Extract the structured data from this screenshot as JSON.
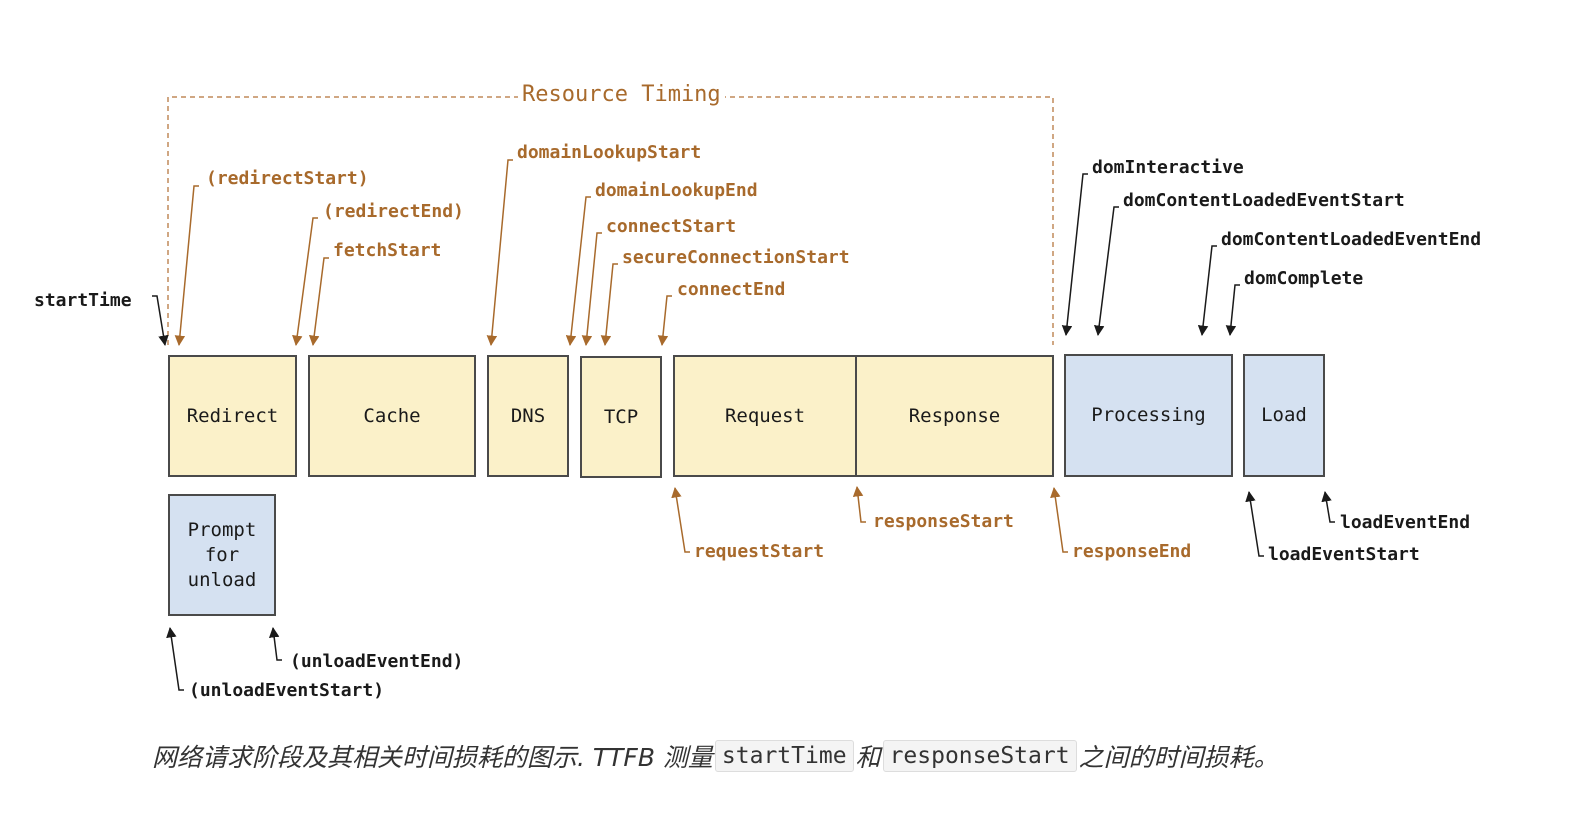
{
  "diagram": {
    "resource_timing_label": "Resource Timing",
    "boxes": {
      "redirect": "Redirect",
      "cache": "Cache",
      "dns": "DNS",
      "tcp": "TCP",
      "request": "Request",
      "response": "Response",
      "processing": "Processing",
      "load": "Load",
      "prompt_for_unload": [
        "Prompt",
        "for",
        "unload"
      ]
    },
    "labels": {
      "start_time": "startTime",
      "redirect_start": "(redirectStart)",
      "redirect_end": "(redirectEnd)",
      "fetch_start": "fetchStart",
      "domain_lookup_start": "domainLookupStart",
      "domain_lookup_end": "domainLookupEnd",
      "connect_start": "connectStart",
      "secure_connection_start": "secureConnectionStart",
      "connect_end": "connectEnd",
      "dom_interactive": "domInteractive",
      "dom_content_loaded_event_start": "domContentLoadedEventStart",
      "dom_content_loaded_event_end": "domContentLoadedEventEnd",
      "dom_complete": "domComplete",
      "request_start": "requestStart",
      "response_start": "responseStart",
      "response_end": "responseEnd",
      "load_event_end": "loadEventEnd",
      "load_event_start": "loadEventStart",
      "unload_event_end": "(unloadEventEnd)",
      "unload_event_start": "(unloadEventStart)"
    },
    "colors": {
      "resource_timing": "#a86a2c",
      "navigation_timing": "#1a1a1a",
      "network_phase_fill": "#fbf1c9",
      "browser_phase_fill": "#d5e1f1",
      "box_border": "#4a4a4a"
    }
  },
  "caption": {
    "text_before": "网络请求阶段及其相关时间损耗的图示. TTFB 测量",
    "code_1": "startTime",
    "text_middle": "和",
    "code_2": "responseStart",
    "text_after": "之间的时间损耗。"
  }
}
